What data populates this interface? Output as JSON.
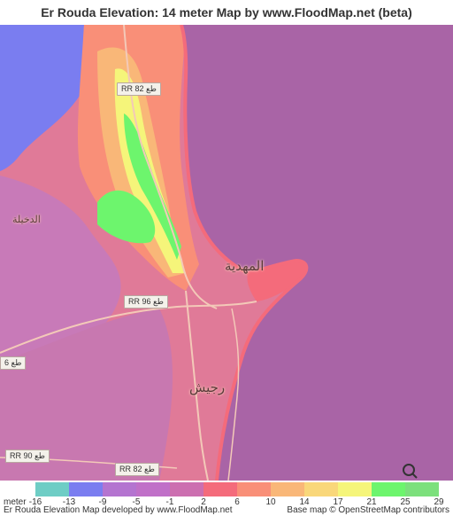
{
  "title": "Er Rouda Elevation: 14 meter Map by www.FloodMap.net (beta)",
  "map": {
    "place_labels": {
      "mahdia": "المهدية",
      "rejiche": "رجيش",
      "dkhila": "الدخيلة"
    },
    "roads": {
      "rr82_north": "RR 82 طع",
      "rr96": "RR 96 طع",
      "rr90": "RR 90 طع",
      "rr82_south": "RR 82 طع",
      "left_edge": "6 طع"
    },
    "watermark": "OpenStreetMap"
  },
  "legend": {
    "unit": "meter",
    "ticks": [
      "-16",
      "-13",
      "-9",
      "-5",
      "-1",
      "2",
      "6",
      "10",
      "14",
      "17",
      "21",
      "25",
      "29"
    ],
    "colors": [
      "#6ecdc5",
      "#7a7df0",
      "#b474d0",
      "#c070c8",
      "#cc6fb0",
      "#f46b7b",
      "#f98f78",
      "#f9b778",
      "#f9d77a",
      "#f5f57a",
      "#6df56d",
      "#7ce07c"
    ]
  },
  "footer": {
    "left": "Er Rouda Elevation Map developed by www.FloodMap.net",
    "right": "Base map © OpenStreetMap contributors"
  }
}
